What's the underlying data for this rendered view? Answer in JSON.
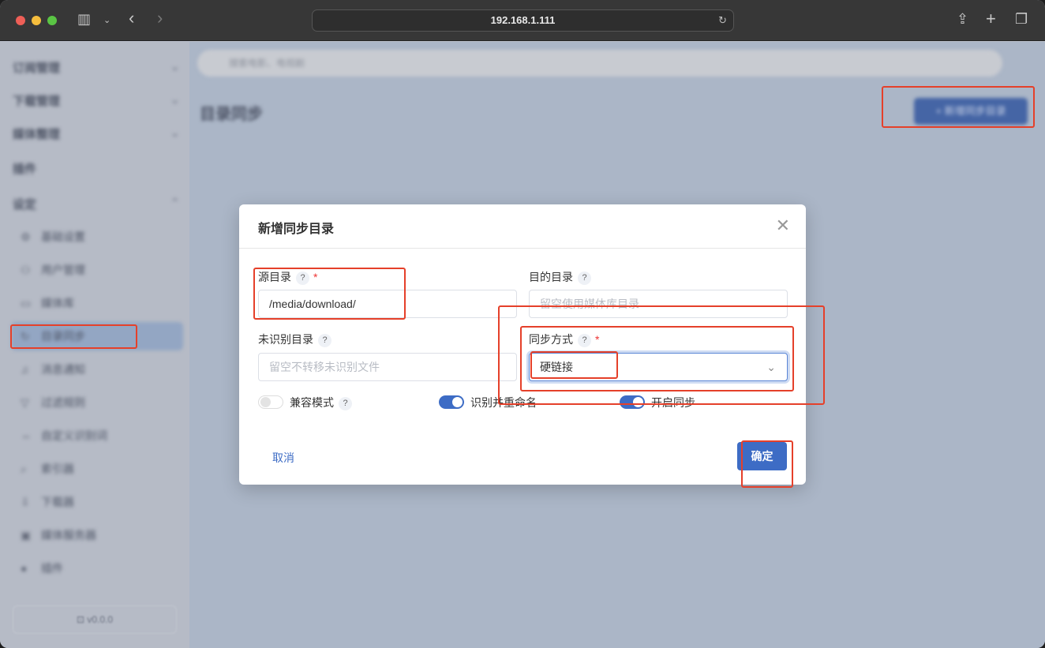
{
  "browser": {
    "url": "192.168.1.111"
  },
  "sidebar": {
    "groups": [
      {
        "label": "订阅管理"
      },
      {
        "label": "下载管理"
      },
      {
        "label": "媒体整理"
      },
      {
        "label": "插件"
      },
      {
        "label": "设定"
      }
    ],
    "items": [
      {
        "label": "基础设置",
        "icon": "⚙"
      },
      {
        "label": "用户管理",
        "icon": "⚇"
      },
      {
        "label": "媒体库",
        "icon": "▭"
      },
      {
        "label": "目录同步",
        "icon": "↻"
      },
      {
        "label": "消息通知",
        "icon": "♫"
      },
      {
        "label": "过滤规则",
        "icon": "▽"
      },
      {
        "label": "自定义识别词",
        "icon": "⇔"
      },
      {
        "label": "索引器",
        "icon": "⌕"
      },
      {
        "label": "下载器",
        "icon": "⇩"
      },
      {
        "label": "媒体服务器",
        "icon": "▣"
      },
      {
        "label": "插件",
        "icon": "●"
      }
    ],
    "version": "v0.0.0"
  },
  "main": {
    "search_placeholder": "搜索电影、电视剧",
    "page_title": "目录同步",
    "add_button": "+ 新增同步目录"
  },
  "dialog": {
    "title": "新增同步目录",
    "source_label": "源目录",
    "source_value": "/media/download/",
    "dest_label": "目的目录",
    "dest_placeholder": "留空使用媒体库目录",
    "unknown_label": "未识别目录",
    "unknown_placeholder": "留空不转移未识别文件",
    "mode_label": "同步方式",
    "mode_value": "硬链接",
    "compat_label": "兼容模式",
    "compat_on": false,
    "rename_label": "识别并重命名",
    "rename_on": true,
    "enable_label": "开启同步",
    "enable_on": true,
    "help": "?",
    "required": "*",
    "cancel": "取消",
    "ok": "确定"
  }
}
